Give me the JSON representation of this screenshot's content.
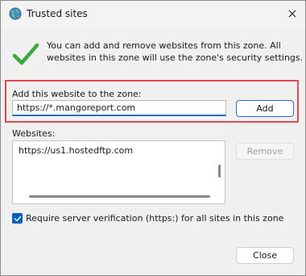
{
  "window": {
    "title": "Trusted sites",
    "icon": "globe-icon",
    "close_icon": "close-icon"
  },
  "info": {
    "icon": "checkmark-icon",
    "text": "You can add and remove websites from this zone. All websites in this zone will use the zone's security settings."
  },
  "add_site": {
    "label": "Add this website to the zone:",
    "value": "https://*.mangoreport.com",
    "button_label": "Add"
  },
  "websites": {
    "label": "Websites:",
    "items": [
      "https://us1.hostedftp.com"
    ],
    "remove_label": "Remove"
  },
  "require_https": {
    "checked": true,
    "label": "Require server verification (https:) for all sites in this zone"
  },
  "close_button": {
    "label": "Close"
  },
  "colors": {
    "highlight": "#e0474f",
    "accent": "#005fb8",
    "check_green": "#3ca83c"
  }
}
